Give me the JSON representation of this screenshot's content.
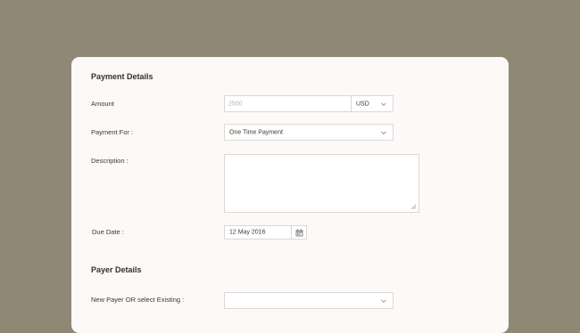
{
  "payment_details": {
    "title": "Payment Details",
    "amount": {
      "label": "Amount",
      "placeholder": "2500",
      "currency": "USD"
    },
    "payment_for": {
      "label": "Payment For :",
      "value": "One Time Payment"
    },
    "description": {
      "label": "Description :",
      "value": ""
    },
    "due_date": {
      "label": "Due Date :",
      "value": "12 May 2016",
      "icon": "calendar-icon"
    }
  },
  "payer_details": {
    "title": "Payer Details",
    "payer_select": {
      "label": "New Payer OR select Existing :",
      "value": ""
    }
  },
  "colors": {
    "background": "#8f8875",
    "card": "#fcf9f8",
    "border": "#dcd8d4",
    "text": "#3b3937"
  }
}
